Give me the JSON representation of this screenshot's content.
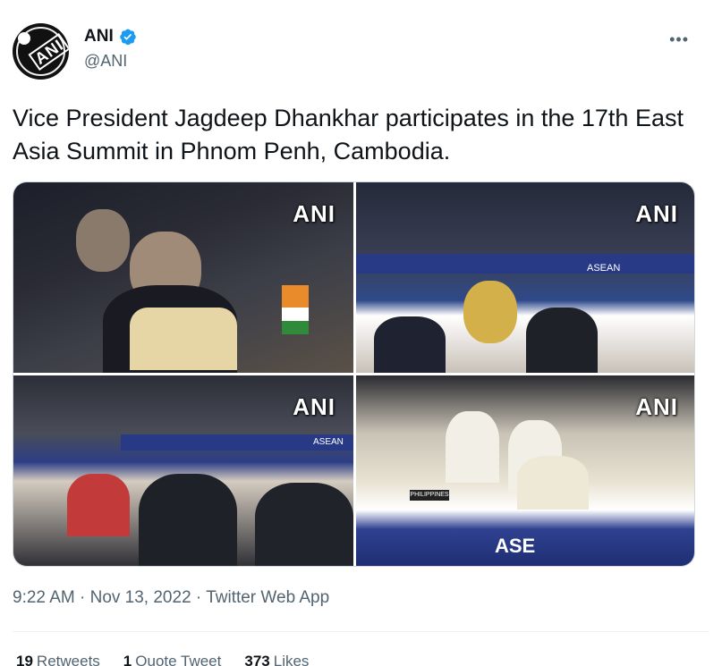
{
  "account": {
    "display_name": "ANI",
    "handle": "@ANI",
    "avatar_text": "ANI",
    "verified": true
  },
  "menu": {
    "more_label": "•••"
  },
  "tweet": {
    "text": "Vice President Jagdeep Dhankhar participates in the 17th East Asia Summit in Phnom Penh, Cambodia.",
    "photos": [
      {
        "watermark": "ANI",
        "banner": ""
      },
      {
        "watermark": "ANI",
        "banner": "ASEAN"
      },
      {
        "watermark": "ANI",
        "banner": "ASEAN"
      },
      {
        "watermark": "ANI",
        "banner": "ASE",
        "nameplate": "PHILIPPINES"
      }
    ]
  },
  "meta": {
    "time": "9:22 AM",
    "date": "Nov 13, 2022",
    "source": "Twitter Web App",
    "separator": " · "
  },
  "stats": {
    "retweets_count": "19",
    "retweets_label": "Retweets",
    "quotes_count": "1",
    "quotes_label": "Quote Tweet",
    "likes_count": "373",
    "likes_label": "Likes"
  },
  "colors": {
    "verified_blue": "#1d9bf0",
    "text_primary": "#0f1419",
    "text_secondary": "#536471"
  }
}
